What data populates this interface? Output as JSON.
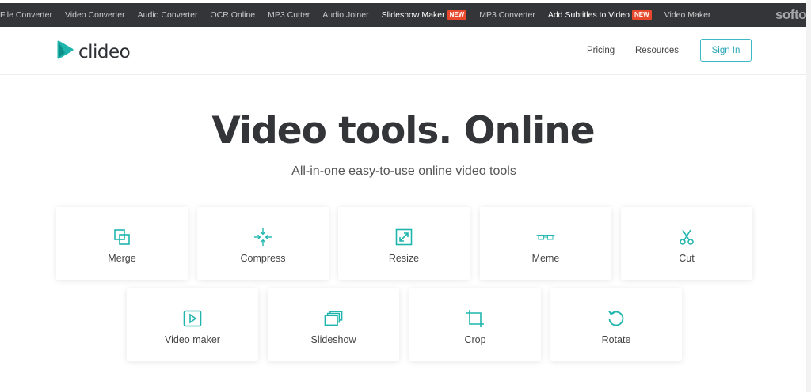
{
  "topbar": {
    "links": [
      {
        "label": "File Converter"
      },
      {
        "label": "Video Converter"
      },
      {
        "label": "Audio Converter"
      },
      {
        "label": "OCR Online"
      },
      {
        "label": "MP3 Cutter"
      },
      {
        "label": "Audio Joiner"
      },
      {
        "label": "Slideshow Maker",
        "badge": "NEW"
      },
      {
        "label": "MP3 Converter"
      },
      {
        "label": "Add Subtitles to Video",
        "badge": "NEW"
      },
      {
        "label": "Video Maker"
      }
    ],
    "brand": "softo"
  },
  "header": {
    "logo_text": "clideo",
    "nav": {
      "pricing": "Pricing",
      "resources": "Resources"
    },
    "signin": "Sign In"
  },
  "hero": {
    "title": "Video tools. Online",
    "subtitle": "All-in-one easy-to-use online video tools"
  },
  "tools": {
    "row1": [
      {
        "label": "Merge",
        "icon": "merge-icon"
      },
      {
        "label": "Compress",
        "icon": "compress-icon"
      },
      {
        "label": "Resize",
        "icon": "resize-icon"
      },
      {
        "label": "Meme",
        "icon": "meme-icon"
      },
      {
        "label": "Cut",
        "icon": "scissors-icon"
      }
    ],
    "row2": [
      {
        "label": "Video maker",
        "icon": "play-icon"
      },
      {
        "label": "Slideshow",
        "icon": "slideshow-icon"
      },
      {
        "label": "Crop",
        "icon": "crop-icon"
      },
      {
        "label": "Rotate",
        "icon": "rotate-icon"
      }
    ]
  },
  "colors": {
    "accent": "#1fb5ad",
    "topbar_bg": "#333538",
    "badge": "#e8492c"
  }
}
